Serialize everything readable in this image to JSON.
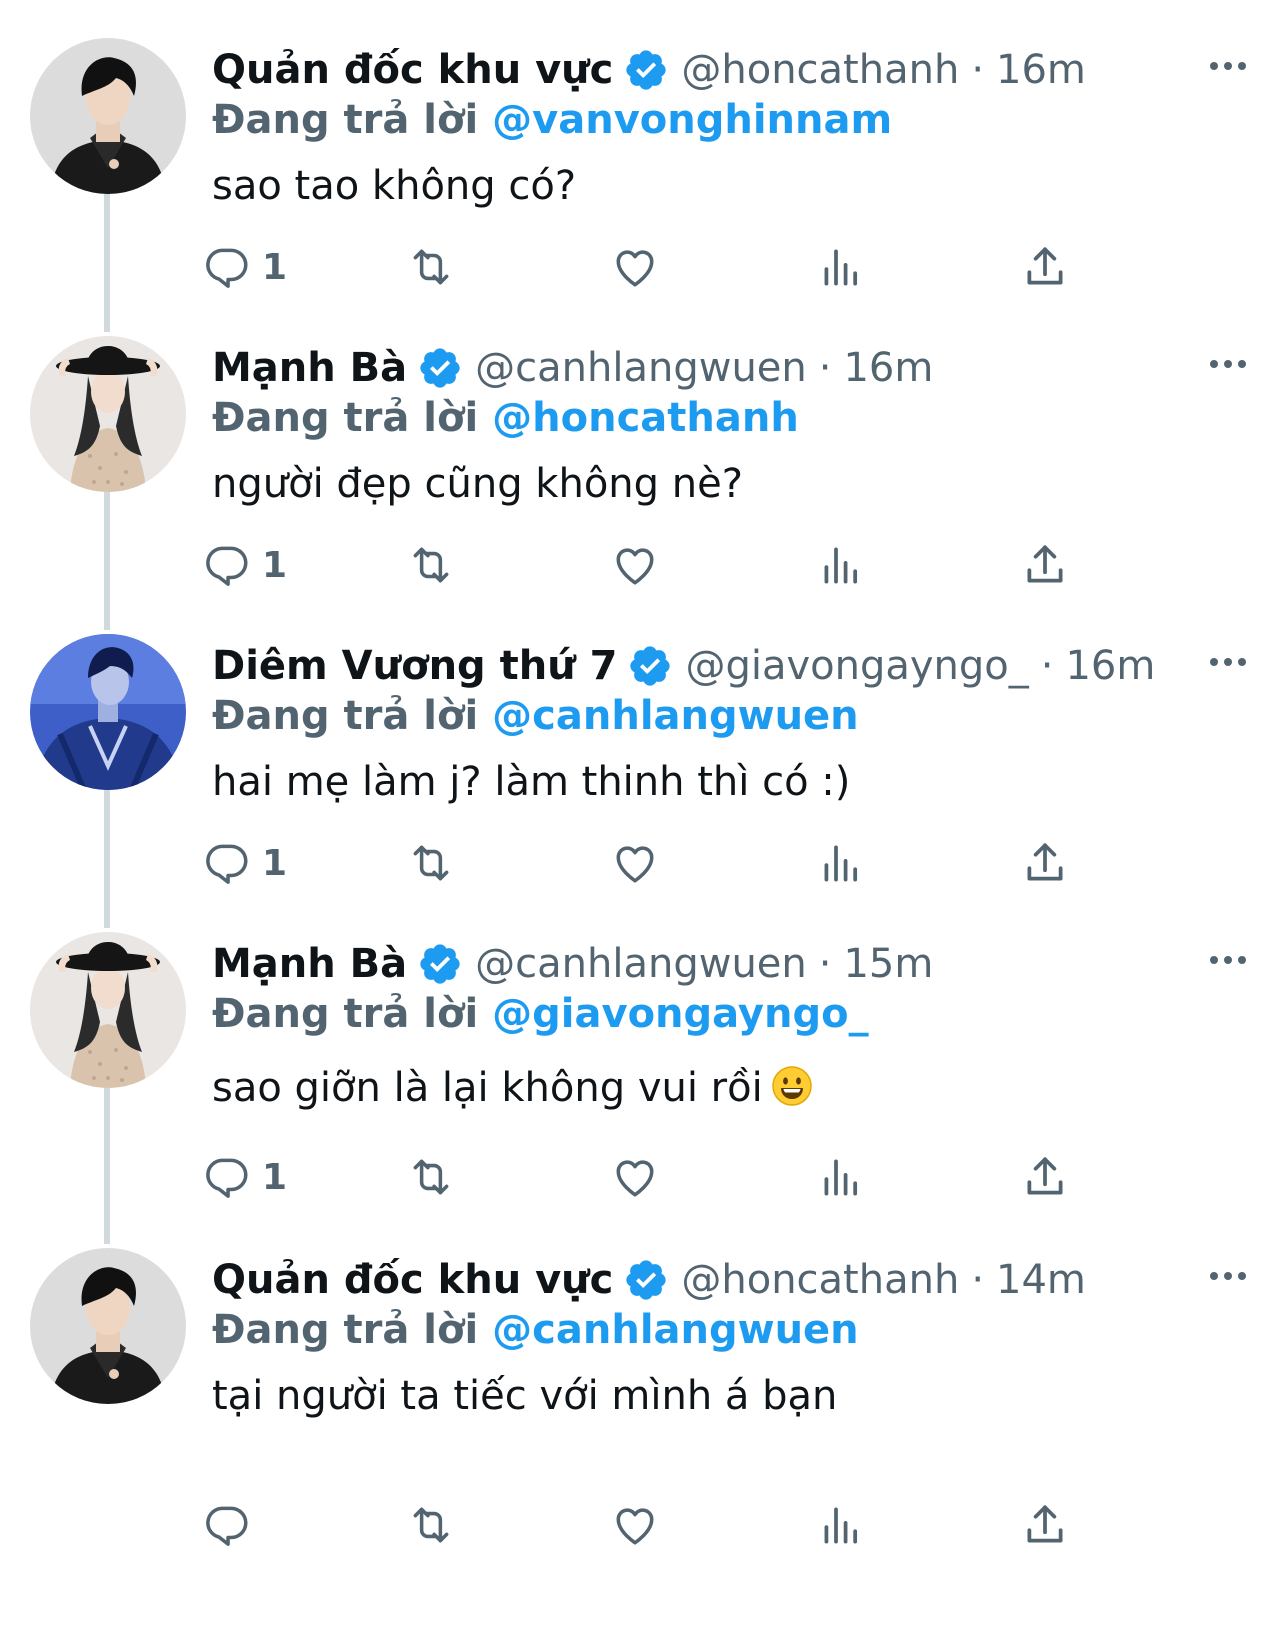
{
  "tweets": [
    {
      "name": "Quản đốc khu vực",
      "handle": "@honcathanh",
      "dot": "·",
      "time": "16m",
      "reply_prefix": "Đang trả lời",
      "reply_to": "@vanvonghinnam",
      "text": "sao tao không có?",
      "reply_count": "1",
      "avatar_icon": "avatar-man-dark-jacket"
    },
    {
      "name": "Mạnh Bà",
      "handle": "@canhlangwuen",
      "dot": "·",
      "time": "16m",
      "reply_prefix": "Đang trả lời",
      "reply_to": "@honcathanh",
      "text": "người đẹp cũng không nè?",
      "reply_count": "1",
      "avatar_icon": "avatar-woman-black-hat"
    },
    {
      "name": "Diêm Vương thứ 7",
      "handle": "@giavongayngo_",
      "dot": "·",
      "time": "16m",
      "reply_prefix": "Đang trả lời",
      "reply_to": "@canhlangwuen",
      "text": "hai mẹ làm j? làm thinh thì có :)",
      "reply_count": "1",
      "avatar_icon": "avatar-man-blue-jacket"
    },
    {
      "name": "Mạnh Bà",
      "handle": "@canhlangwuen",
      "dot": "·",
      "time": "15m",
      "reply_prefix": "Đang trả lời",
      "reply_to": "@giavongayngo_",
      "text": "sao giỡn là lại không vui rồi",
      "emoji": "smiley-emoji",
      "reply_count": "1",
      "avatar_icon": "avatar-woman-black-hat"
    },
    {
      "name": "Quản đốc khu vực",
      "handle": "@honcathanh",
      "dot": "·",
      "time": "14m",
      "reply_prefix": "Đang trả lời",
      "reply_to": "@canhlangwuen",
      "text": "tại người ta tiếc với mình á bạn",
      "reply_count": "",
      "avatar_icon": "avatar-man-dark-jacket"
    }
  ],
  "colors": {
    "text": "#0f1419",
    "secondary": "#536471",
    "accent": "#1d9bf0",
    "thread_line": "#cfd9de"
  },
  "icons": {
    "verified": "verified-badge-icon",
    "more": "more-horizontal-icon",
    "reply": "reply-icon",
    "retweet": "retweet-icon",
    "like": "like-heart-icon",
    "views": "views-chart-icon",
    "share": "share-icon"
  }
}
